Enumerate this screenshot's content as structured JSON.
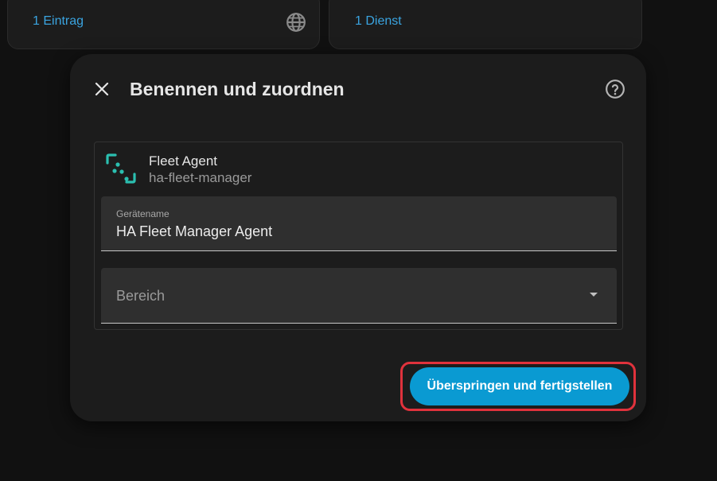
{
  "background": {
    "cards": [
      {
        "link_label": "1 Eintrag",
        "icon": "globe-icon"
      },
      {
        "link_label": "1 Dienst"
      }
    ]
  },
  "dialog": {
    "title": "Benennen und zuordnen",
    "close_icon": "close-icon",
    "help_icon": "help-circle-icon",
    "device": {
      "name": "Fleet Agent",
      "subtitle": "ha-fleet-manager",
      "icon": "fleet-agent-logo-icon"
    },
    "device_name_field": {
      "label": "Gerätename",
      "value": "HA Fleet Manager Agent"
    },
    "area_field": {
      "placeholder": "Bereich"
    },
    "finish_button": {
      "label": "Überspringen und fertigstellen"
    }
  },
  "colors": {
    "accent": "#0a9ad2",
    "link": "#3aa4e0",
    "highlight": "#e0323c",
    "logo": "#2bbfb0"
  }
}
